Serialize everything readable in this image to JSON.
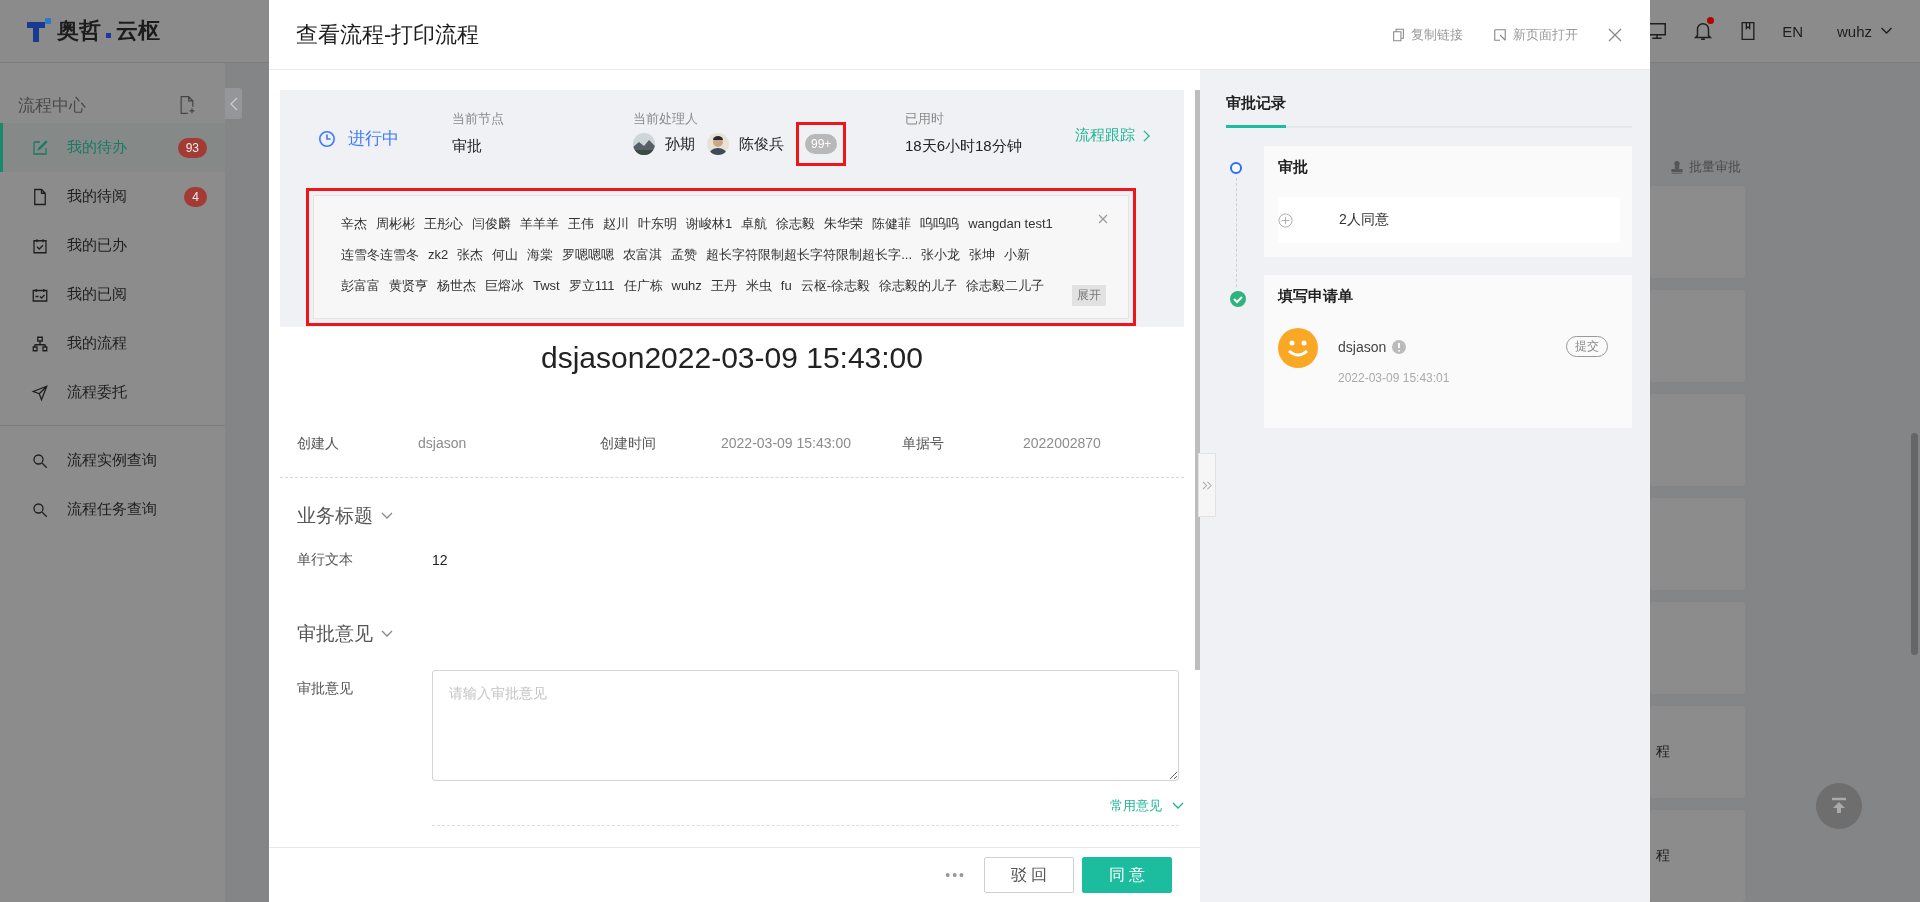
{
  "header": {
    "brand": {
      "left": "奥哲",
      "right": "云枢"
    },
    "language": "EN",
    "user": "wuhz",
    "notification_dot": true
  },
  "sidebar": {
    "title": "流程中心",
    "items": [
      {
        "label": "我的待办",
        "badge": "93",
        "selected": true
      },
      {
        "label": "我的待阅",
        "badge": "4",
        "selected": false
      },
      {
        "label": "我的已办",
        "selected": false
      },
      {
        "label": "我的已阅",
        "selected": false
      },
      {
        "label": "我的流程",
        "selected": false
      },
      {
        "label": "流程委托",
        "selected": false
      }
    ],
    "queries": [
      {
        "label": "流程实例查询",
        "selected": false
      },
      {
        "label": "流程任务查询",
        "selected": false
      }
    ]
  },
  "background": {
    "batch_button": "批量审批",
    "card_texts": [
      "程",
      "程"
    ]
  },
  "modal": {
    "title": "查看流程-打印流程",
    "actions": [
      "复制链接",
      "新页面打开"
    ],
    "status": {
      "state": "进行中",
      "node_label": "当前节点",
      "node": "审批",
      "handler_label": "当前处理人",
      "handlers": [
        {
          "name": "孙期"
        },
        {
          "name": "陈俊兵"
        }
      ],
      "more": {
        "text": "99+",
        "highlighted": true
      },
      "elapsed_label": "已用时",
      "elapsed": "18天6小时18分钟",
      "track": "流程跟踪"
    },
    "handler_list": {
      "highlighted": true,
      "expand": "展开",
      "lines": [
        {
          "names": [
            "辛杰",
            "周彬彬",
            "王彤心",
            "闫俊麟",
            "羊羊羊",
            "王伟",
            "赵川",
            "叶东明",
            "谢峻林1",
            "卓航",
            "徐志毅",
            "朱华荣",
            "陈健菲",
            "呜呜呜",
            "wangdan test1"
          ]
        },
        {
          "names": [
            "连雪冬连雪冬",
            "zk2",
            "张杰",
            "何山",
            "海棠",
            "罗嗯嗯嗯",
            "农富淇",
            "孟赞",
            "超长字符限制超长字符限制超长字...",
            "张小龙",
            "张坤",
            "小新"
          ]
        },
        {
          "names": [
            "彭富富",
            "黄贤亨",
            "杨世杰",
            "巨熔冰",
            "Twst",
            "罗立111",
            "任广栋",
            "wuhz",
            "王丹",
            "米虫",
            "fu",
            "云枢-徐志毅",
            "徐志毅的儿子",
            "徐志毅二儿子"
          ]
        }
      ]
    },
    "doc_title": "dsjason2022-03-09 15:43:00",
    "meta": [
      {
        "label": "创建人",
        "value": "dsjason"
      },
      {
        "label": "创建时间",
        "value": "2022-03-09 15:43:00"
      },
      {
        "label": "单据号",
        "value": "2022002870"
      }
    ],
    "business": {
      "title": "业务标题",
      "fields": [
        {
          "label": "单行文本",
          "value": "12"
        }
      ]
    },
    "opinion": {
      "title": "审批意见",
      "label": "审批意见",
      "placeholder": "请输入审批意见",
      "common": "常用意见"
    },
    "footer": {
      "more": "•••",
      "buttons": [
        {
          "label": "驳 回",
          "kind": "default"
        },
        {
          "label": "同 意",
          "kind": "primary"
        }
      ]
    },
    "record": {
      "tab": "审批记录",
      "steps": [
        {
          "title": "审批",
          "completed": false,
          "summary": "2人同意"
        },
        {
          "title": "填写申请单",
          "completed": true,
          "user": "dsjason",
          "action": "提交",
          "time": "2022-03-09 15:43:01"
        }
      ]
    }
  }
}
